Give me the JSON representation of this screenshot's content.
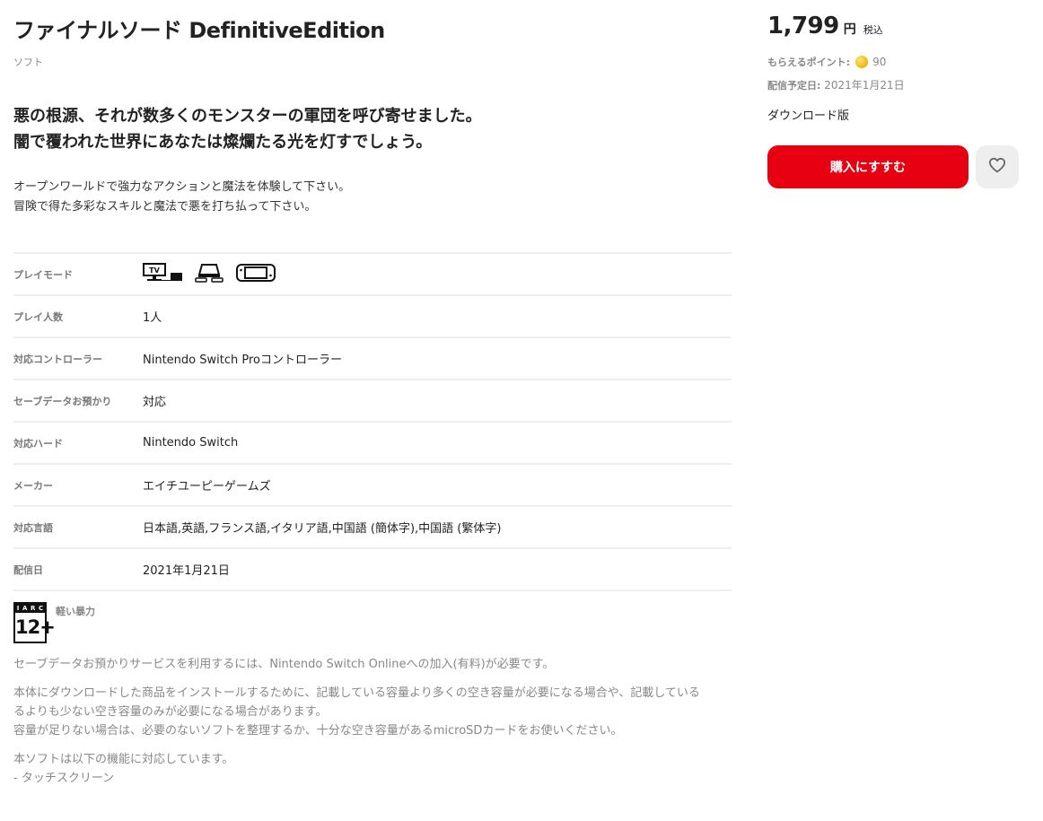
{
  "product": {
    "title": "ファイナルソード DefinitiveEdition",
    "category": "ソフト",
    "catch_line1": "悪の根源、それが数多くのモンスターの軍団を呼び寄せました。",
    "catch_line2": "闇で覆われた世界にあなたは燦爛たる光を灯すでしょう。",
    "desc_line1": "オープンワールドで強力なアクションと魔法を体験して下さい。",
    "desc_line2": "冒険で得た多彩なスキルと魔法で悪を打ち払って下さい。"
  },
  "specs": {
    "play_mode": {
      "label": "プレイモード",
      "icons": [
        "tv-mode-icon",
        "tabletop-mode-icon",
        "handheld-mode-icon"
      ]
    },
    "players": {
      "label": "プレイ人数",
      "value": "1人"
    },
    "controller": {
      "label": "対応コントローラー",
      "value": "Nintendo Switch Proコントローラー"
    },
    "save_data": {
      "label": "セーブデータお預かり",
      "value": "対応"
    },
    "hardware": {
      "label": "対応ハード",
      "value": "Nintendo Switch"
    },
    "maker": {
      "label": "メーカー",
      "value": "エイチユーピーゲームズ"
    },
    "languages": {
      "label": "対応言語",
      "value": "日本語,英語,フランス語,イタリア語,中国語 (簡体字),中国語 (繁体字)"
    },
    "release": {
      "label": "配信日",
      "value": "2021年1月21日"
    }
  },
  "rating": {
    "badge_top": [
      "I",
      "A",
      "R",
      "C"
    ],
    "age": "12+",
    "descriptor": "軽い暴力"
  },
  "notes": {
    "online": "セーブデータお預かりサービスを利用するには、Nintendo Switch Onlineへの加入(有料)が必要です。",
    "storage_line1": "本体にダウンロードした商品をインストールするために、記載している容量より多くの空き容量が必要になる場合や、記載している",
    "storage_line2": "るよりも少ない空き容量のみが必要になる場合があります。",
    "storage_line3": "容量が足りない場合は、必要のないソフトを整理するか、十分な空き容量があるmicroSDカードをお使いください。",
    "features_intro": "本ソフトは以下の機能に対応しています。",
    "feature_touch": "- タッチスクリーン"
  },
  "purchase": {
    "price": "1,799",
    "currency": "円",
    "tax": "税込",
    "points_label": "もらえるポイント:",
    "points_value": "90",
    "release_label": "配信予定日:",
    "release_value": "2021年1月21日",
    "edition": "ダウンロード版",
    "buy_label": "購入にすすむ",
    "favorite_icon": "heart-icon"
  },
  "colors": {
    "accent": "#e60012",
    "coin": "#f0b400"
  }
}
